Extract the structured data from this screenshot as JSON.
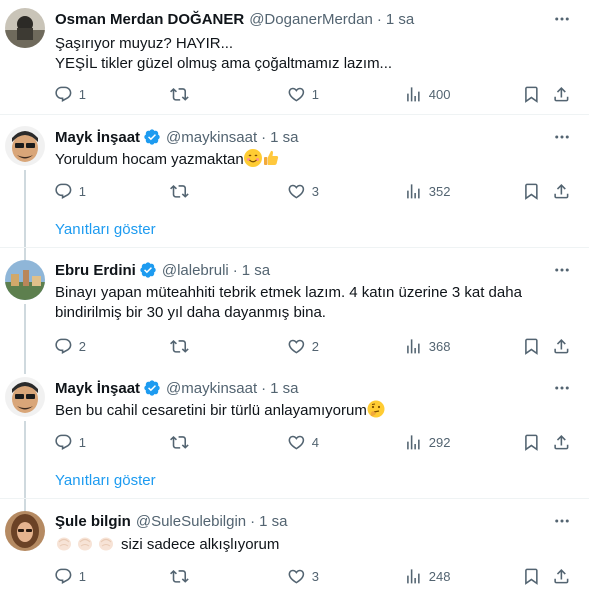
{
  "tweets": [
    {
      "name": "Osman Merdan DOĞANER",
      "handle": "@DoganerMerdan",
      "time": "1 sa",
      "lines": [
        "Şaşırıyor muyuz? HAYIR...",
        "YEŞİL tikler güzel olmuş ama çoğaltmamız lazım..."
      ],
      "replies": "1",
      "retweets": "",
      "likes": "1",
      "views": "400",
      "verified": false
    },
    {
      "name": "Mayk İnşaat",
      "handle": "@maykinsaat",
      "time": "1 sa",
      "lines": [
        "Yoruldum hocam yazmaktan"
      ],
      "replies": "1",
      "retweets": "",
      "likes": "3",
      "views": "352",
      "verified": true,
      "emojis": [
        "smiling-face-emoji",
        "thumbs-up-emoji"
      ]
    },
    {
      "name": "Ebru Erdini",
      "handle": "@lalebruli",
      "time": "1 sa",
      "lines": [
        "Binayı yapan müteahhiti tebrik etmek lazım. 4 katın üzerine 3 kat daha",
        "bindirilmiş bir 30 yıl daha dayanmış bina."
      ],
      "replies": "2",
      "retweets": "",
      "likes": "2",
      "views": "368",
      "verified": true
    },
    {
      "name": "Mayk İnşaat",
      "handle": "@maykinsaat",
      "time": "1 sa",
      "lines": [
        "Ben bu cahil cesaretini bir türlü anlayamıyorum"
      ],
      "replies": "1",
      "retweets": "",
      "likes": "4",
      "views": "292",
      "verified": true,
      "emojis": [
        "thinking-face-emoji"
      ]
    },
    {
      "name": "Şule bilgin",
      "handle": "@SuleSulebilgin",
      "time": "1 sa",
      "lines": [
        "sizi sadece alkışlıyorum"
      ],
      "replies": "1",
      "retweets": "",
      "likes": "3",
      "views": "248",
      "verified": false,
      "emojis": [
        "clapping-hands-emoji",
        "clapping-hands-emoji",
        "clapping-hands-emoji"
      ]
    }
  ],
  "show_replies_label": "Yanıtları göster",
  "dot": "·",
  "colors": {
    "accent": "#1d9bf0",
    "secondary_text": "#536471",
    "divider": "#eff3f4",
    "thread_line": "#cfd9de"
  },
  "icons": [
    "more-icon",
    "reply-icon",
    "retweet-icon",
    "like-icon",
    "views-icon",
    "bookmark-icon",
    "share-icon",
    "verified-badge-icon"
  ]
}
